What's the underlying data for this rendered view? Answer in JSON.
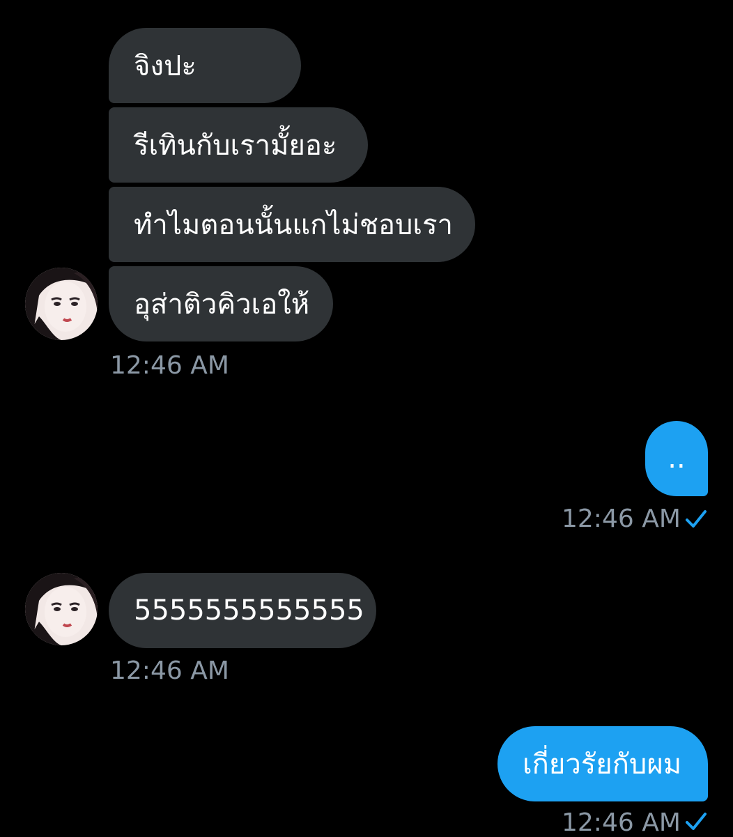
{
  "colors": {
    "background": "#000000",
    "incoming_bubble": "#2f3336",
    "outgoing_bubble": "#1da1f2",
    "timestamp": "#8b98a5",
    "read_check": "#1da1f2"
  },
  "group1": {
    "messages": [
      "จิงปะ",
      "รีเทินกับเรามั้ยอะ",
      "ทำไมตอนนั้นแกไม่ชอบเรา",
      "อุส่าติวคิวเอให้"
    ],
    "timestamp": "12:46 AM",
    "avatar_icon": "profile-avatar"
  },
  "group2": {
    "message": "..",
    "timestamp": "12:46 AM",
    "status_icon": "read-check-icon"
  },
  "group3": {
    "message": "5555555555555",
    "timestamp": "12:46 AM",
    "avatar_icon": "profile-avatar"
  },
  "group4": {
    "message": "เกี่ยวรัยกับผม",
    "timestamp": "12:46 AM",
    "status_icon": "read-check-icon"
  }
}
